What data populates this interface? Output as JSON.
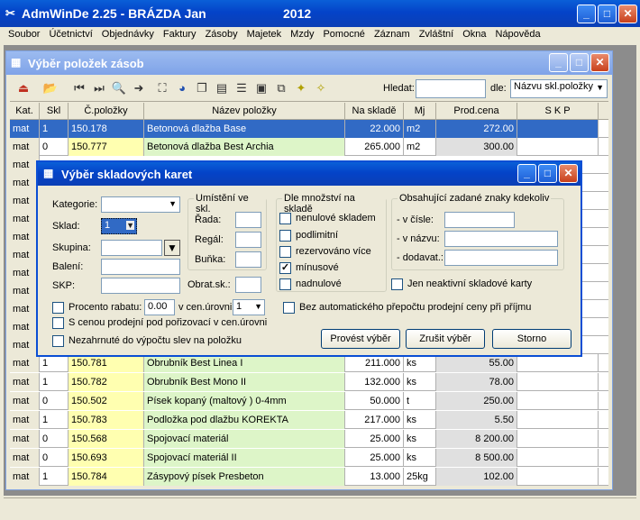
{
  "main_window": {
    "title": "AdmWinDe 2.25 - BRÁZDA Jan",
    "year": "2012"
  },
  "menu": [
    "Soubor",
    "Účetnictví",
    "Objednávky",
    "Faktury",
    "Zásoby",
    "Majetek",
    "Mzdy",
    "Pomocné",
    "Záznam",
    "Zvláštní",
    "Okna",
    "Nápověda"
  ],
  "child_window": {
    "title": "Výběr položek zásob",
    "search_label": "Hledat:",
    "search_value": "",
    "by_label": "dle:",
    "by_value": "Názvu skl.položky"
  },
  "grid": {
    "headers": [
      "Kat.",
      "Skl",
      "Č.položky",
      "Název položky",
      "Na skladě",
      "Mj",
      "Prod.cena",
      "S K P"
    ],
    "rows_top": [
      {
        "kat": "mat",
        "skl": "1",
        "cis": "150.178",
        "naz": "Betonová dlažba Base",
        "sklad": "22.000",
        "mj": "m2",
        "cena": "272.00",
        "skp": ""
      },
      {
        "kat": "mat",
        "skl": "0",
        "cis": "150.777",
        "naz": "Betonová dlažba Best Archia",
        "sklad": "265.000",
        "mj": "m2",
        "cena": "300.00",
        "skp": ""
      }
    ],
    "hidden_kat": [
      "mat",
      "mat",
      "mat",
      "mat",
      "mat",
      "mat",
      "mat",
      "mat",
      "mat",
      "mat",
      "mat"
    ],
    "rows_bottom": [
      {
        "kat": "mat",
        "skl": "1",
        "cis": "150.781",
        "naz": "Obrubník Best Linea I",
        "sklad": "211.000",
        "mj": "ks",
        "cena": "55.00",
        "skp": ""
      },
      {
        "kat": "mat",
        "skl": "1",
        "cis": "150.782",
        "naz": "Obrubník Best Mono II",
        "sklad": "132.000",
        "mj": "ks",
        "cena": "78.00",
        "skp": ""
      },
      {
        "kat": "mat",
        "skl": "0",
        "cis": "150.502",
        "naz": "Písek kopaný (maltový ) 0-4mm",
        "sklad": "50.000",
        "mj": "t",
        "cena": "250.00",
        "skp": ""
      },
      {
        "kat": "mat",
        "skl": "1",
        "cis": "150.783",
        "naz": "Podložka pod dlažbu KOREKTA",
        "sklad": "217.000",
        "mj": "ks",
        "cena": "5.50",
        "skp": ""
      },
      {
        "kat": "mat",
        "skl": "0",
        "cis": "150.568",
        "naz": "Spojovací materiál",
        "sklad": "25.000",
        "mj": "ks",
        "cena": "8 200.00",
        "skp": ""
      },
      {
        "kat": "mat",
        "skl": "0",
        "cis": "150.693",
        "naz": "Spojovací materiál II",
        "sklad": "25.000",
        "mj": "ks",
        "cena": "8 500.00",
        "skp": ""
      },
      {
        "kat": "mat",
        "skl": "1",
        "cis": "150.784",
        "naz": "Zásypový písek Presbeton",
        "sklad": "13.000",
        "mj": "25kg",
        "cena": "102.00",
        "skp": ""
      }
    ]
  },
  "dialog": {
    "title": "Výběr skladových karet",
    "kategorie_label": "Kategorie:",
    "sklad_label": "Sklad:",
    "sklad_value": "1",
    "skupina_label": "Skupina:",
    "baleni_label": "Balení:",
    "skp_label": "SKP:",
    "umisteni_title": "Umístění ve skl.",
    "rada_label": "Řada:",
    "regal_label": "Regál:",
    "bunka_label": "Buňka:",
    "obrat_label": "Obrat.sk.:",
    "mnozstvi_title": "Dle množství na skladě",
    "mnozstvi_options": [
      {
        "label": "nenulové skladem",
        "checked": false
      },
      {
        "label": "podlimitní",
        "checked": false
      },
      {
        "label": "rezervováno více",
        "checked": false
      },
      {
        "label": "mínusové",
        "checked": true
      },
      {
        "label": "nadnulové",
        "checked": false
      }
    ],
    "znaky_title": "Obsahující zadané znaky kdekoliv",
    "v_cisle_label": "- v čísle:",
    "v_nazvu_label": "- v názvu:",
    "dodavat_label": "- dodavat.:",
    "neaktivni_label": "Jen neaktivní skladové karty",
    "procento_label": "Procento rabatu:",
    "procento_value": "0.00",
    "v_cen_urovni_label": "v cen.úrovni:",
    "cen_uroven_value": "1",
    "s_cenou_label": "S cenou prodejní pod pořizovací v cen.úrovni",
    "bez_prepoctu_label": "Bez automatického přepočtu prodejní ceny při příjmu",
    "nezahrnute_label": "Nezahrnuté do výpočtu slev na položku",
    "provest_button": "Provést výběr",
    "zrusit_button": "Zrušit výběr",
    "storno_button": "Storno"
  }
}
